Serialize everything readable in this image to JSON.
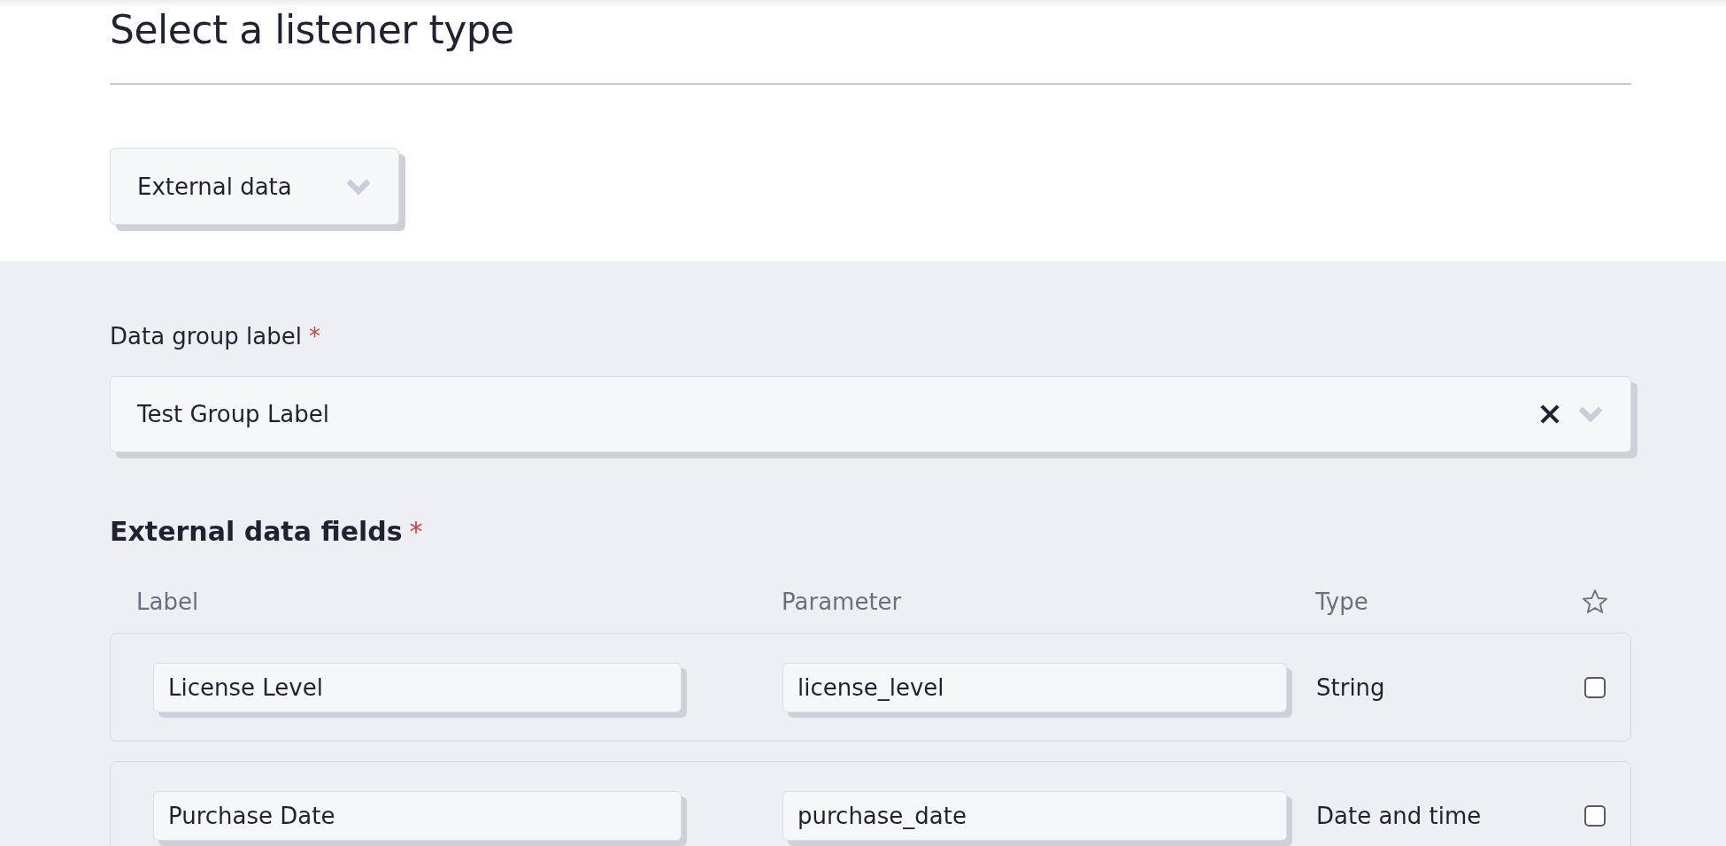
{
  "title": "Select a listener type",
  "listener_type": {
    "value": "External data"
  },
  "data_group": {
    "label": "Data group label",
    "required_mark": "*",
    "value": "Test Group Label"
  },
  "fields_section": {
    "heading": "External data fields",
    "required_mark": "*",
    "columns": [
      "Label",
      "Parameter",
      "Type"
    ],
    "rows": [
      {
        "label": "License Level",
        "parameter": "license_level",
        "type": "String",
        "checked": false
      },
      {
        "label": "Purchase Date",
        "parameter": "purchase_date",
        "type": "Date and time",
        "checked": false
      }
    ]
  }
}
